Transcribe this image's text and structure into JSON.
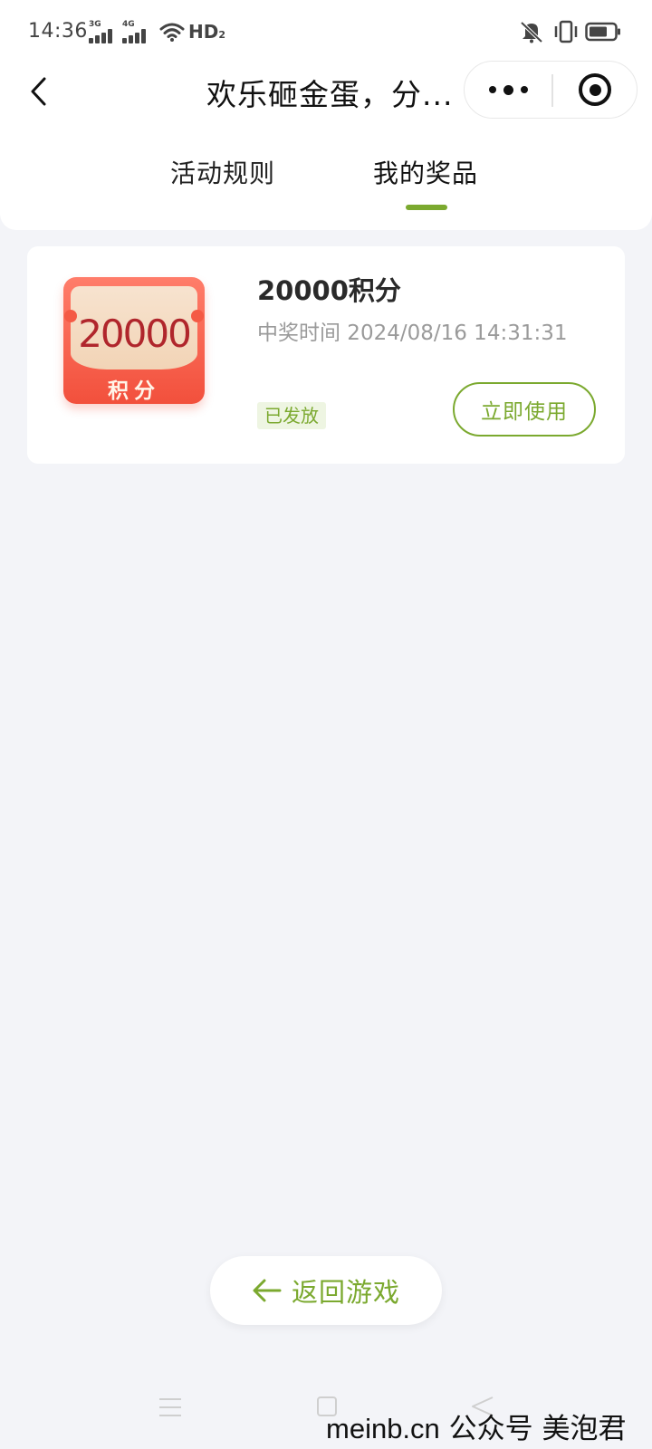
{
  "status_bar": {
    "time": "14:36",
    "signal_1": "3G",
    "signal_2": "4G",
    "hd": "HD",
    "hd_sub": "2"
  },
  "nav": {
    "title": "欢乐砸金蛋，分..."
  },
  "tabs": [
    {
      "label": "活动规则",
      "active": false
    },
    {
      "label": "我的奖品",
      "active": true
    }
  ],
  "colors": {
    "accent": "#7ba92f",
    "coupon_red": "#f2503c",
    "background": "#f3f4f8"
  },
  "prizes": [
    {
      "coupon_amount": "20000",
      "coupon_unit": "积分",
      "name": "20000积分",
      "time": "中奖时间 2024/08/16 14:31:31",
      "status": "已发放",
      "action": "立即使用"
    }
  ],
  "back_to_game": {
    "label": "返回游戏"
  },
  "watermark": {
    "site": "meinb.cn",
    "text": "公众号 美泡君"
  }
}
